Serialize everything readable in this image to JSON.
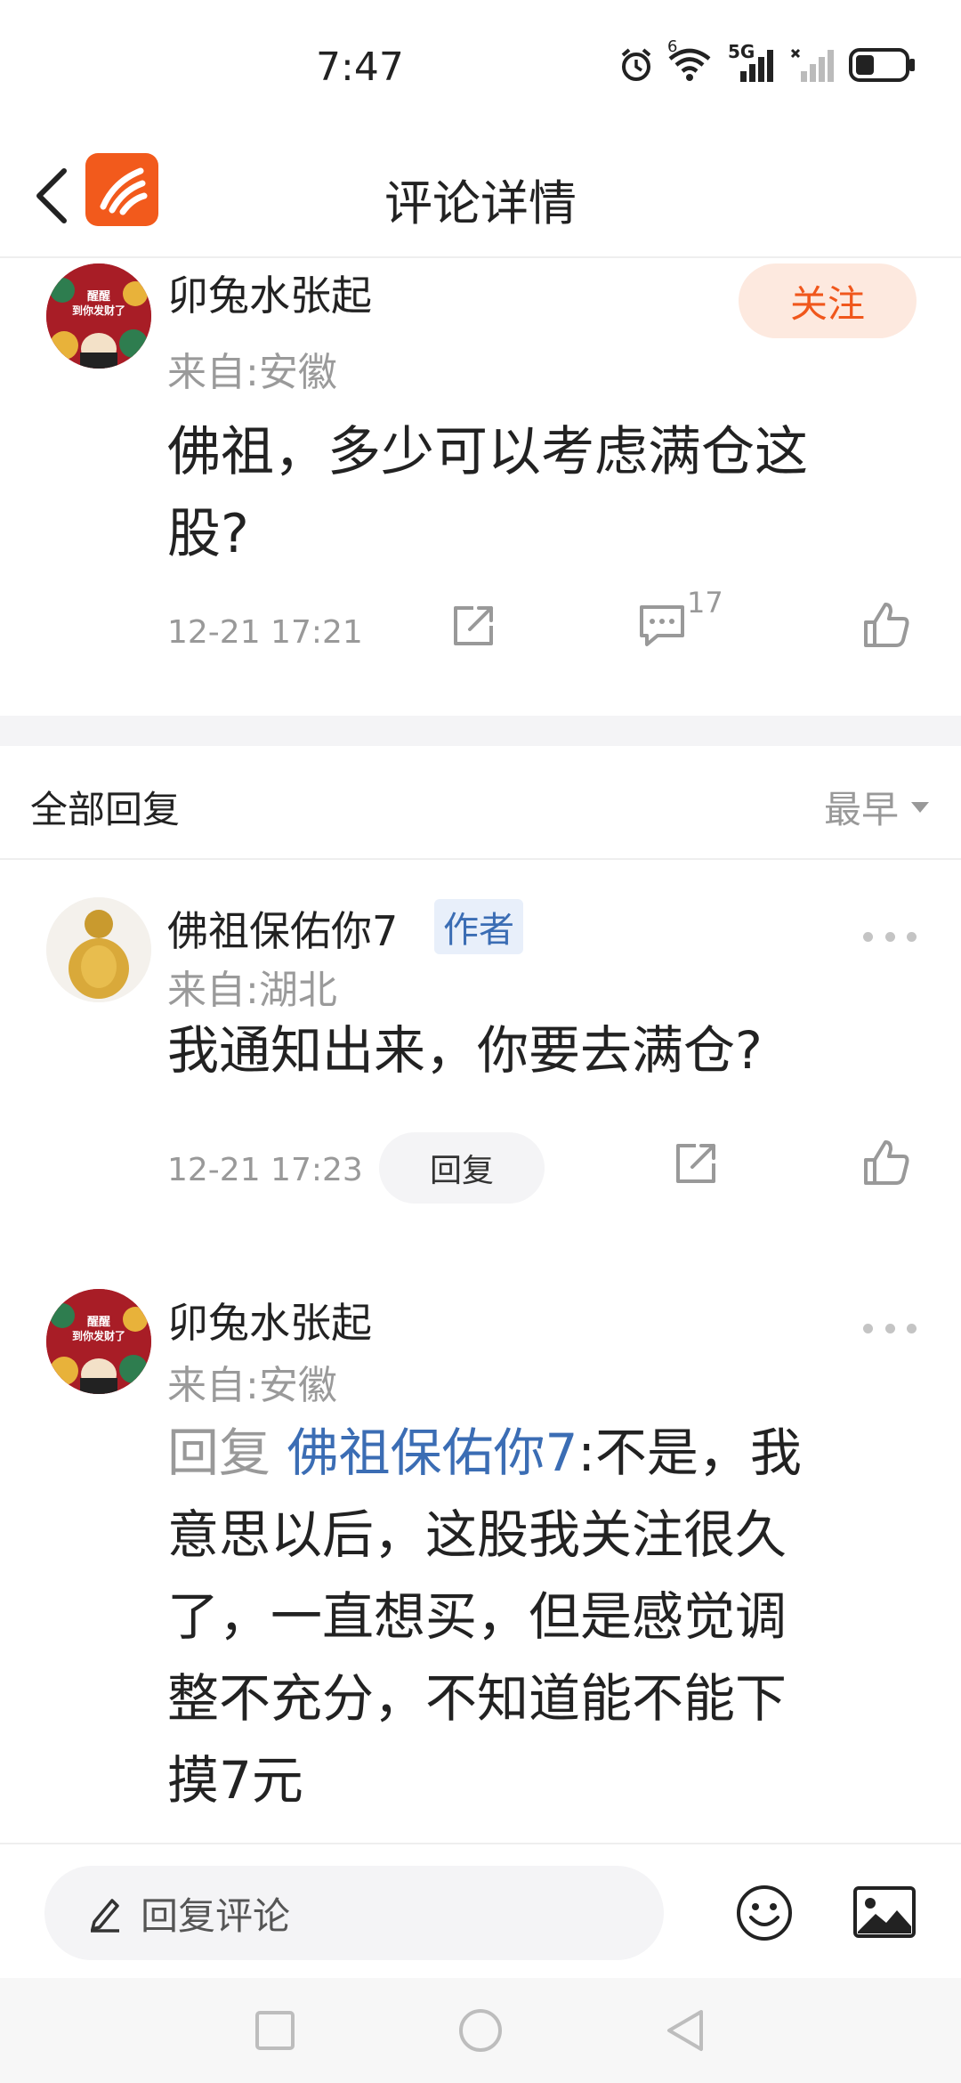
{
  "status_bar": {
    "time": "7:47",
    "network_label": "5G",
    "wifi_label": "6"
  },
  "nav": {
    "title": "评论详情",
    "back_icon": "chevron-left-icon",
    "logo_icon": "app-logo-icon"
  },
  "main_comment": {
    "user_name": "卯兔水张起",
    "location": "来自:安徽",
    "follow_label": "关注",
    "text_line1": "佛祖，多少可以考虑满仓这",
    "text_line2": "股?",
    "timestamp": "12-21 17:21",
    "comment_count": "17",
    "avatar_caption_1": "醒醒",
    "avatar_caption_2": "到你发财了"
  },
  "replies_header": {
    "title": "全部回复",
    "sort_label": "最早"
  },
  "replies": [
    {
      "user_name": "佛祖保佑你7",
      "author_tag": "作者",
      "location": "来自:湖北",
      "text": "我通知出来，你要去满仓?",
      "timestamp": "12-21 17:23",
      "reply_button": "回复"
    },
    {
      "user_name": "卯兔水张起",
      "location": "来自:安徽",
      "reply_prefix": "回复",
      "mention": "佛祖保佑你7",
      "text_line1": ":不是，我",
      "text_line2": "意思以后，这股我关注很久",
      "text_line3": "了，一直想买，但是感觉调",
      "text_line4": "整不充分，不知道能不能下",
      "text_line5": "摸7元"
    }
  ],
  "bottom_bar": {
    "input_placeholder": "回复评论"
  },
  "colors": {
    "accent": "#f0571c",
    "link": "#3b6db4",
    "muted": "#999999"
  }
}
